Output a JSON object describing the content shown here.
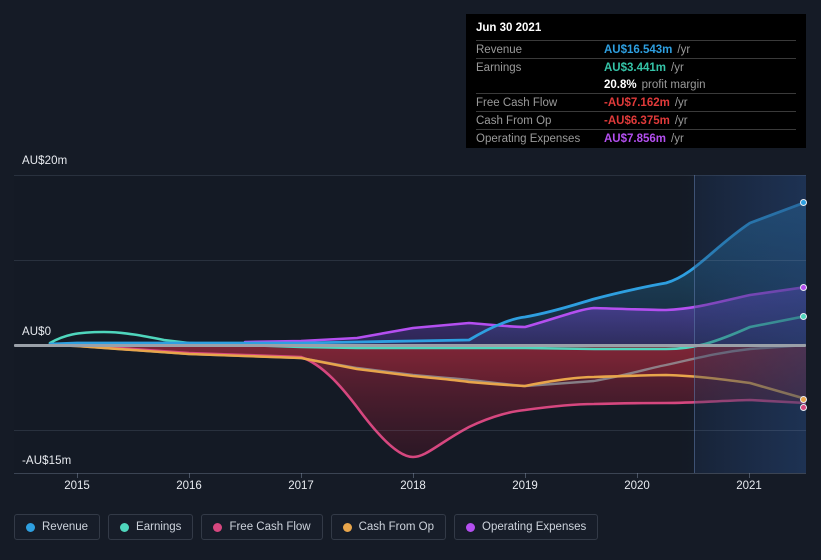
{
  "tooltip": {
    "title": "Jun 30 2021",
    "rows": [
      {
        "key": "Revenue",
        "value": "AU$16.543m",
        "unit": "/yr",
        "color": "#2e9fe0"
      },
      {
        "key": "Earnings",
        "value": "AU$3.441m",
        "unit": "/yr",
        "color": "#35c4a8"
      },
      {
        "key": "Free Cash Flow",
        "value": "-AU$7.162m",
        "unit": "/yr",
        "color": "#e03a3a"
      },
      {
        "key": "Cash From Op",
        "value": "-AU$6.375m",
        "unit": "/yr",
        "color": "#e03a3a"
      },
      {
        "key": "Operating Expenses",
        "value": "AU$7.856m",
        "unit": "/yr",
        "color": "#b44ff0"
      }
    ],
    "profit_margin_value": "20.8%",
    "profit_margin_label": "profit margin"
  },
  "legend": [
    {
      "label": "Revenue",
      "color": "#2e9fe0"
    },
    {
      "label": "Earnings",
      "color": "#4fd6bd"
    },
    {
      "label": "Free Cash Flow",
      "color": "#d6477f"
    },
    {
      "label": "Cash From Op",
      "color": "#e8a54b"
    },
    {
      "label": "Operating Expenses",
      "color": "#b44ff0"
    }
  ],
  "axis": {
    "y_labels": [
      "AU$20m",
      "AU$0",
      "-AU$15m"
    ],
    "x_labels": [
      "2015",
      "2016",
      "2017",
      "2018",
      "2019",
      "2020",
      "2021"
    ]
  },
  "chart_data": {
    "type": "line",
    "title": "",
    "xlabel": "",
    "ylabel": "AU$ millions",
    "ylim": [
      -15,
      20
    ],
    "grid": true,
    "legend_position": "bottom",
    "currency": "AU$",
    "units": "millions per year",
    "x": [
      2014.7,
      2015,
      2015.5,
      2016,
      2016.5,
      2017,
      2017.5,
      2018,
      2018.5,
      2019,
      2019.5,
      2020,
      2020.5,
      2021,
      2021.5
    ],
    "series": [
      {
        "name": "Revenue",
        "color": "#2e9fe0",
        "values": [
          0.1,
          0.2,
          0.2,
          0.2,
          0.2,
          0.2,
          0.3,
          0.4,
          0.5,
          3.2,
          5.0,
          6.4,
          7.1,
          11.5,
          16.543
        ]
      },
      {
        "name": "Earnings",
        "color": "#4fd6bd",
        "values": [
          0.3,
          1.2,
          1.4,
          0.9,
          0.2,
          -0.3,
          -0.4,
          -0.4,
          -0.4,
          -0.4,
          -0.4,
          -0.5,
          -0.5,
          1.2,
          3.441
        ]
      },
      {
        "name": "Free Cash Flow",
        "color": "#d6477f",
        "values": [
          0.2,
          0.3,
          0.1,
          -0.5,
          -0.9,
          -1.2,
          -5.8,
          -13.2,
          -9.0,
          -6.6,
          -6.0,
          -6.2,
          -6.1,
          -5.6,
          -7.162
        ]
      },
      {
        "name": "Cash From Op",
        "color": "#e8a54b",
        "values": [
          0.2,
          0.2,
          0.0,
          -0.6,
          -1.0,
          -1.3,
          -2.8,
          -3.6,
          -3.9,
          -4.3,
          -4.4,
          -4.1,
          -4.0,
          -4.1,
          -6.375
        ]
      },
      {
        "name": "Operating Expenses",
        "color": "#b44ff0",
        "values": [
          null,
          null,
          null,
          null,
          0.4,
          0.5,
          0.8,
          2.0,
          2.6,
          2.2,
          4.3,
          5.8,
          5.6,
          6.4,
          7.856
        ]
      }
    ],
    "forecast_region": {
      "from": 2020.6,
      "to": 2021.6,
      "label": ""
    },
    "zero_line": 0
  }
}
